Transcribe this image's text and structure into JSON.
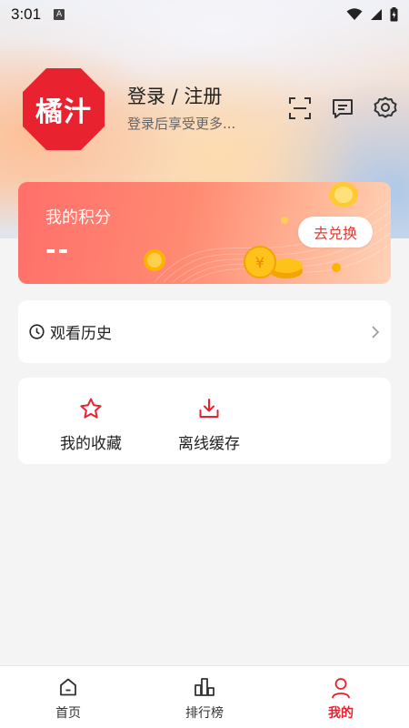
{
  "status_bar": {
    "time": "3:01",
    "indicator": "A",
    "icons": [
      "wifi-icon",
      "signal-icon",
      "battery-icon"
    ]
  },
  "profile": {
    "avatar_text": "橘汁",
    "login_title": "登录 / 注册",
    "login_subtitle": "登录后享受更多...",
    "brand_color": "#e8232f",
    "header_icons": [
      "scan-icon",
      "message-icon",
      "settings-icon"
    ]
  },
  "points": {
    "title": "我的积分",
    "value": "--",
    "redeem_label": "去兑换"
  },
  "history": {
    "label": "观看历史",
    "icon": "clock-icon"
  },
  "actions": [
    {
      "label": "我的收藏",
      "icon": "star-icon"
    },
    {
      "label": "离线缓存",
      "icon": "download-icon"
    }
  ],
  "bottom_nav": {
    "active_color": "#e8232f",
    "items": [
      {
        "label": "首页",
        "icon": "home-icon",
        "active": false
      },
      {
        "label": "排行榜",
        "icon": "ranking-icon",
        "active": false
      },
      {
        "label": "我的",
        "icon": "profile-icon",
        "active": true
      }
    ]
  }
}
